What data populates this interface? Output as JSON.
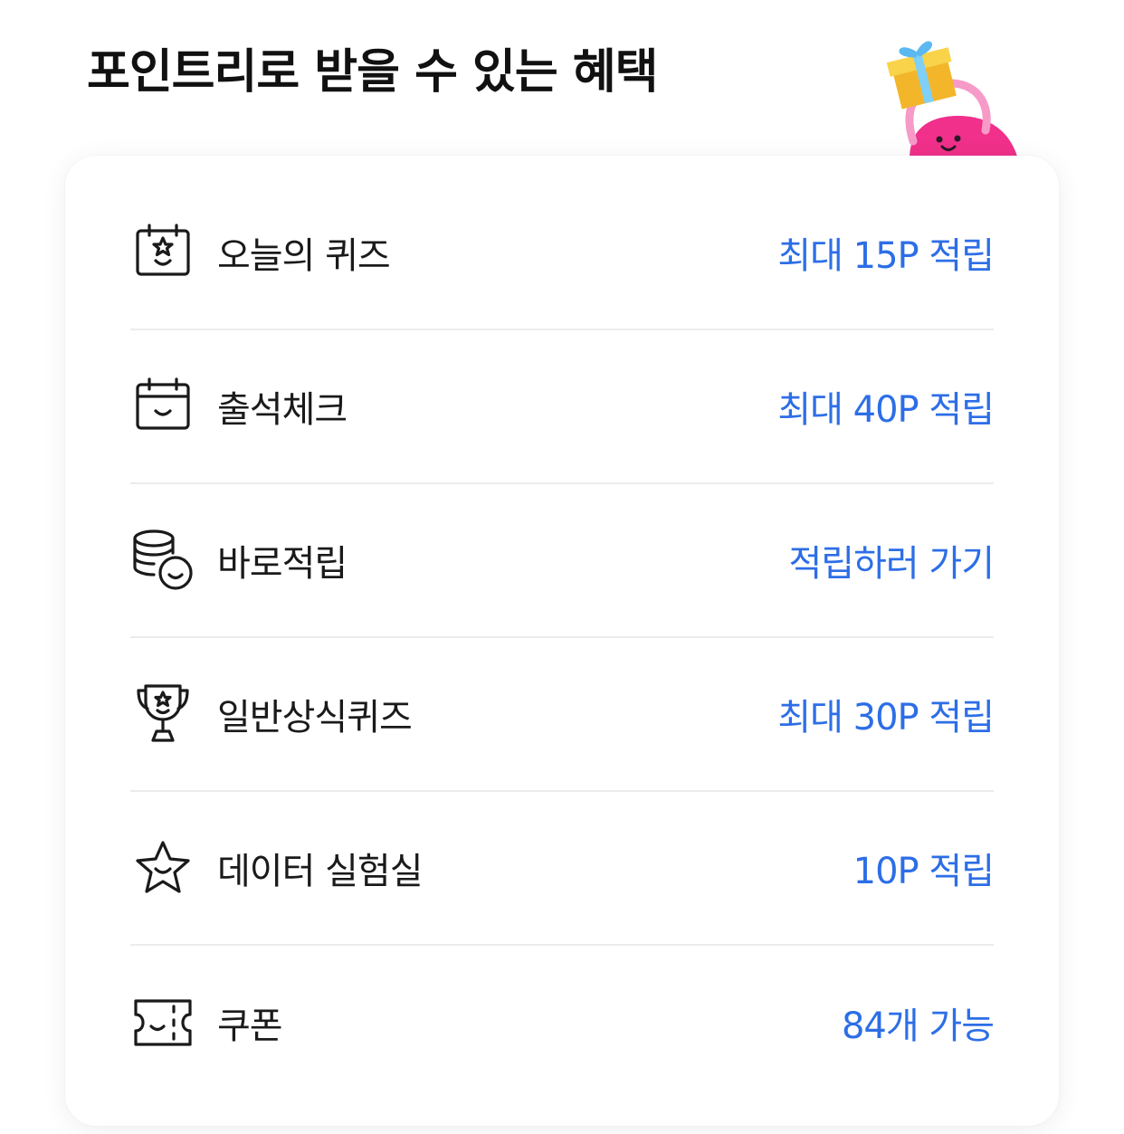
{
  "header": {
    "title": "포인트리로 받을 수 있는 혜택"
  },
  "mascot": {
    "icon": "gift-mascot-icon"
  },
  "colors": {
    "accent": "#2d6ee6",
    "text": "#1a1a1a",
    "divider": "#ececec",
    "mascot_pink": "#f0308a",
    "gift_yellow": "#f7c934",
    "ribbon_blue": "#5bb8f0"
  },
  "benefits": [
    {
      "icon": "quiz-calendar-icon",
      "label": "오늘의 퀴즈",
      "value": "최대 15P 적립"
    },
    {
      "icon": "calendar-icon",
      "label": "출석체크",
      "value": "최대 40P 적립"
    },
    {
      "icon": "coins-icon",
      "label": "바로적립",
      "value": "적립하러 가기"
    },
    {
      "icon": "trophy-icon",
      "label": "일반상식퀴즈",
      "value": "최대 30P 적립"
    },
    {
      "icon": "star-icon",
      "label": "데이터 실험실",
      "value": "10P 적립"
    },
    {
      "icon": "ticket-icon",
      "label": "쿠폰",
      "value": "84개 가능"
    }
  ]
}
